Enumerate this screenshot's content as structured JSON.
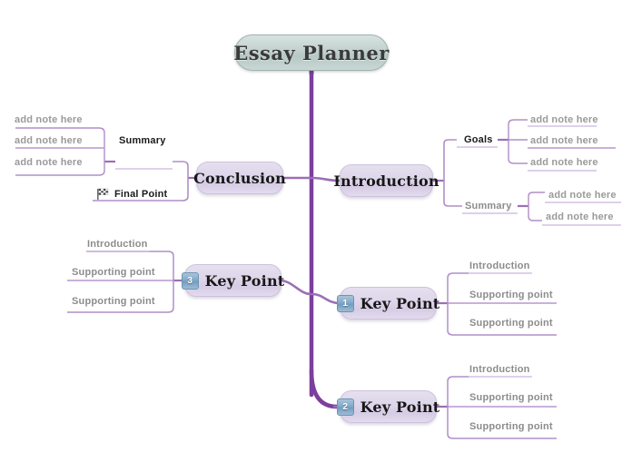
{
  "document": {
    "title": "Essay Planner",
    "background_color": "#ffffff"
  },
  "colors": {
    "trunk": "#7b3f9d",
    "branch": "#9b6fb5",
    "twig": "#c0a3d4",
    "root_fill": "#c3d2cf",
    "topic_fill": "#ded6ea",
    "badge_fill": "#7ea6c6",
    "note_text": "#9a9a9a",
    "label_text": "#8c8c8c",
    "dark_text": "#1a1a1a"
  },
  "root": {
    "label": "Essay Planner"
  },
  "topics": {
    "introduction": {
      "label": "Introduction"
    },
    "conclusion": {
      "label": "Conclusion"
    },
    "key_point_1": {
      "label": "Key Point",
      "number": "1",
      "icon": "number-badge-1"
    },
    "key_point_2": {
      "label": "Key Point",
      "number": "2",
      "icon": "number-badge-2"
    },
    "key_point_3": {
      "label": "Key Point",
      "number": "3",
      "icon": "number-badge-3"
    }
  },
  "branches": {
    "introduction": {
      "goals": {
        "label": "Goals",
        "notes": [
          "add note here",
          "add note here",
          "add note here"
        ]
      },
      "summary": {
        "label": "Summary",
        "notes": [
          "add note here",
          "add note here"
        ]
      }
    },
    "conclusion": {
      "summary": {
        "label": "Summary",
        "notes": [
          "add note here",
          "add note here",
          "add note here"
        ]
      },
      "final_point": {
        "label": "Final Point",
        "icon": "checkered-flag-icon"
      }
    },
    "key_point_1": {
      "items": [
        "Introduction",
        "Supporting point",
        "Supporting point"
      ]
    },
    "key_point_2": {
      "items": [
        "Introduction",
        "Supporting point",
        "Supporting point"
      ]
    },
    "key_point_3": {
      "items": [
        "Introduction",
        "Supporting point",
        "Supporting point"
      ]
    }
  }
}
